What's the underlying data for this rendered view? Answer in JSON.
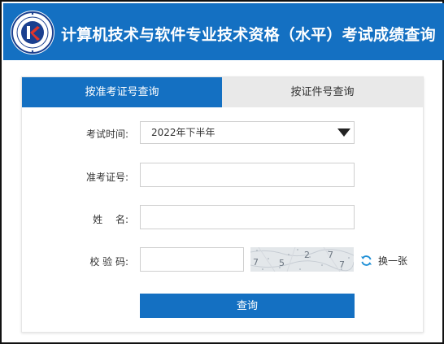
{
  "header": {
    "title": "计算机技术与软件专业技术资格（水平）考试成绩查询"
  },
  "tabs": [
    {
      "label": "按准考证号查询",
      "active": true
    },
    {
      "label": "按证件号查询",
      "active": false
    }
  ],
  "form": {
    "exam_time_label": "考试时间:",
    "exam_time_value": "2022年下半年",
    "ticket_label": "准考证号:",
    "ticket_value": "",
    "name_label": "姓　 名:",
    "name_value": "",
    "captcha_label": "校 验 码:",
    "captcha_value": "",
    "captcha_chars": [
      "7",
      "5",
      "2",
      "7",
      "7"
    ],
    "refresh_label": "换一张",
    "submit_label": "查询"
  },
  "colors": {
    "primary": "#1470c2",
    "tab_inactive": "#e9e9e9",
    "refresh_icon": "#1e8fd6"
  },
  "icons": {
    "logo": "exam-logo-icon",
    "dropdown": "triangle-down-icon",
    "refresh": "refresh-icon"
  }
}
